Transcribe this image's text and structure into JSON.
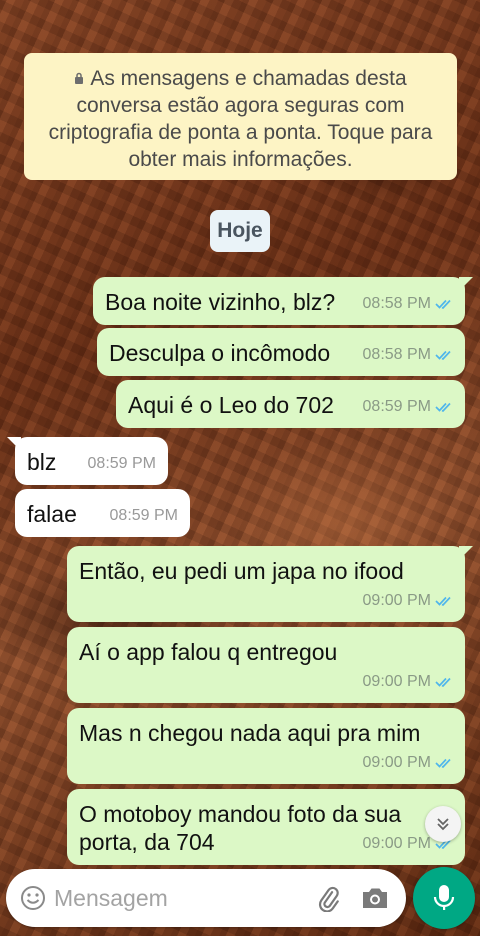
{
  "encryption_notice": "As mensagens e chamadas desta conversa estão agora seguras com criptografia de ponta a ponta. Toque para obter mais informações.",
  "date_divider": "Hoje",
  "messages": [
    {
      "dir": "out",
      "text": "Boa noite vizinho, blz?",
      "time": "08:58 PM",
      "status": "read"
    },
    {
      "dir": "out",
      "text": "Desculpa o incômodo",
      "time": "08:58 PM",
      "status": "read"
    },
    {
      "dir": "out",
      "text": "Aqui é o Leo do 702",
      "time": "08:59 PM",
      "status": "read"
    },
    {
      "dir": "in",
      "text": "blz",
      "time": "08:59 PM"
    },
    {
      "dir": "in",
      "text": "falae",
      "time": "08:59 PM"
    },
    {
      "dir": "out",
      "text": "Então, eu pedi um japa no ifood",
      "time": "09:00 PM",
      "status": "read"
    },
    {
      "dir": "out",
      "text": "Aí o app falou q entregou",
      "time": "09:00 PM",
      "status": "read"
    },
    {
      "dir": "out",
      "text": "Mas n chegou nada aqui pra mim",
      "time": "09:00 PM",
      "status": "read"
    },
    {
      "dir": "out",
      "text": "O motoboy mandou foto da sua porta, da 704",
      "time": "09:00 PM",
      "status": "read"
    }
  ],
  "composer": {
    "placeholder": "Mensagem",
    "icons": [
      "emoji-icon",
      "paperclip-icon",
      "camera-icon",
      "microphone-icon"
    ]
  },
  "colors": {
    "outgoing_bubble": "#dcf8c6",
    "incoming_bubble": "#ffffff",
    "read_ticks": "#4fb6ec",
    "accent": "#00a884",
    "notice_bg": "#fdf4c5"
  }
}
